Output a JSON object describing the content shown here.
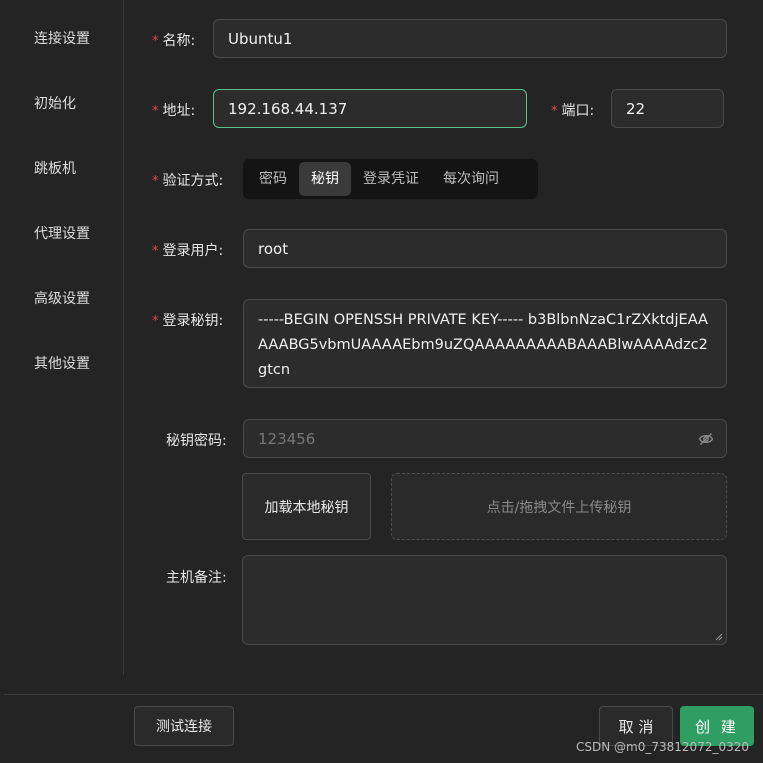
{
  "sidebar": {
    "items": [
      {
        "label": "连接设置"
      },
      {
        "label": "初始化"
      },
      {
        "label": "跳板机"
      },
      {
        "label": "代理设置"
      },
      {
        "label": "高级设置"
      },
      {
        "label": "其他设置"
      }
    ]
  },
  "form": {
    "name": {
      "label": "名称:",
      "value": "Ubuntu1"
    },
    "address": {
      "label": "地址:",
      "value": "192.168.44.137"
    },
    "port": {
      "label": "端口:",
      "value": "22"
    },
    "auth": {
      "label": "验证方式:",
      "options": [
        "密码",
        "秘钥",
        "登录凭证",
        "每次询问"
      ],
      "selected": "秘钥"
    },
    "user": {
      "label": "登录用户:",
      "value": "root"
    },
    "key": {
      "label": "登录秘钥:",
      "value": "-----BEGIN OPENSSH PRIVATE KEY----- b3BlbnNzaC1rZXktdjEAAAAABG5vbmUAAAAEbm9uZQAAAAAAAAABAAABlwAAAAdzc2gtcn"
    },
    "passphrase": {
      "label": "秘钥密码:",
      "placeholder": "123456"
    },
    "load_local_label": "加载本地秘钥",
    "upload_label": "点击/拖拽文件上传秘钥",
    "notes": {
      "label": "主机备注:",
      "value": ""
    }
  },
  "footer": {
    "test_label": "测试连接",
    "cancel_label": "取 消",
    "create_label": "创 建"
  },
  "watermark": "CSDN @m0_73812072_0320",
  "colors": {
    "accent": "#2e9e62",
    "required": "#e0474c",
    "focus_border": "#5fbf8f"
  }
}
